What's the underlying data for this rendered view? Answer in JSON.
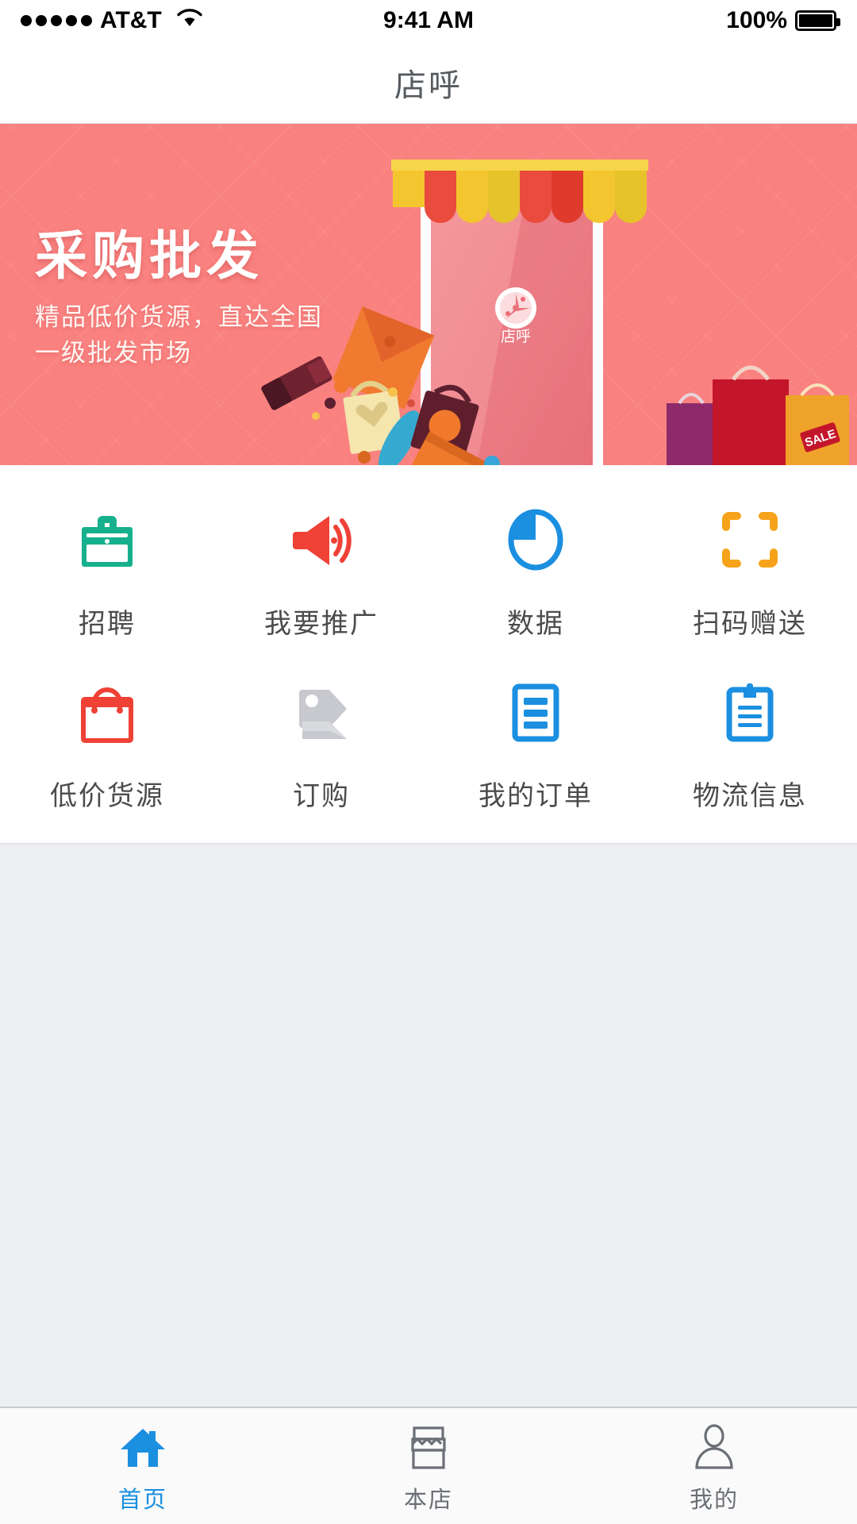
{
  "status_bar": {
    "carrier": "AT&T",
    "signal_dots": 5,
    "wifi_icon": "wifi-icon",
    "time": "9:41 AM",
    "battery_percent": "100%",
    "battery_icon": "battery-full-icon"
  },
  "nav": {
    "title": "店呼"
  },
  "banner": {
    "headline": "采购批发",
    "subline_1": "精品低价货源，直达全国",
    "subline_2": "一级批发市场",
    "app_icon_label": "店呼",
    "sale_tag": "SALE",
    "bg_color": "#f9817f",
    "awning_colors": [
      "#f7d54a",
      "#e94b3c",
      "#f5c842",
      "#e03a2c"
    ],
    "bag_colors": [
      "#8e2a6b",
      "#c4162b",
      "#f0a32a"
    ]
  },
  "grid": {
    "rows": [
      [
        {
          "label": "招聘",
          "icon": "briefcase-icon",
          "color": "#17b08d"
        },
        {
          "label": "我要推广",
          "icon": "megaphone-icon",
          "color": "#ef4136"
        },
        {
          "label": "数据",
          "icon": "pie-chart-icon",
          "color": "#1b8fe0"
        },
        {
          "label": "扫码赠送",
          "icon": "scan-frame-icon",
          "color": "#f6a31b"
        }
      ],
      [
        {
          "label": "低价货源",
          "icon": "shopping-bag-icon",
          "color": "#ef4136"
        },
        {
          "label": "订购",
          "icon": "price-tags-icon",
          "color": "#c7c9ce"
        },
        {
          "label": "我的订单",
          "icon": "order-list-icon",
          "color": "#1b8fe0"
        },
        {
          "label": "物流信息",
          "icon": "clipboard-icon",
          "color": "#1b8fe0"
        }
      ]
    ]
  },
  "tab_bar": {
    "active_color": "#1b8fe0",
    "inactive_color": "#6b6f76",
    "items": [
      {
        "label": "首页",
        "icon": "home-icon",
        "active": true
      },
      {
        "label": "本店",
        "icon": "store-icon",
        "active": false
      },
      {
        "label": "我的",
        "icon": "person-icon",
        "active": false
      }
    ]
  }
}
